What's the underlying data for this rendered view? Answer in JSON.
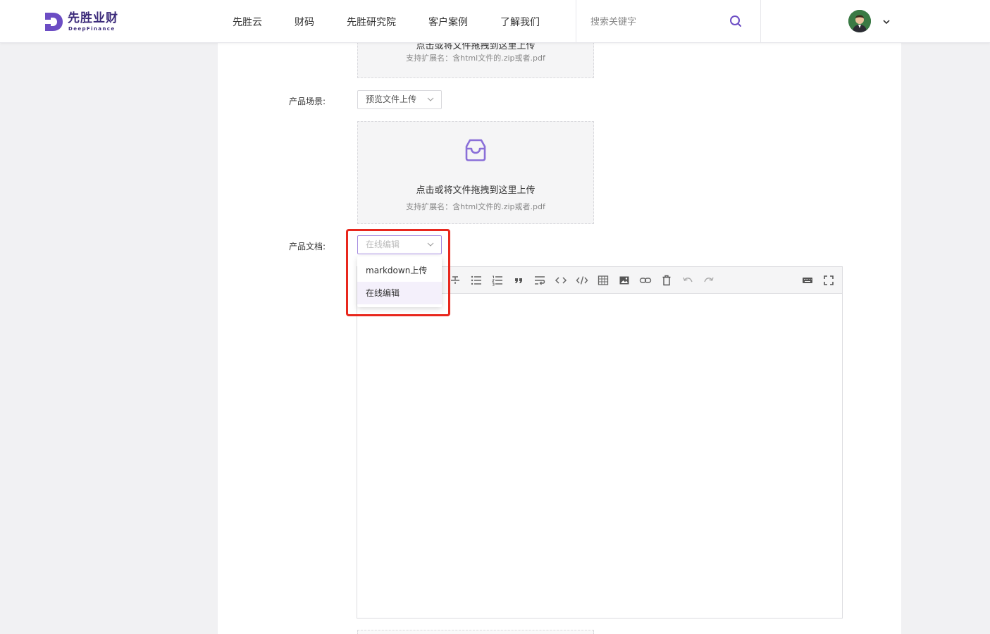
{
  "brand": {
    "name": "先胜业财",
    "sub": "DeepFinance",
    "color": "#6c4dc4"
  },
  "nav": [
    "先胜云",
    "财码",
    "先胜研究院",
    "客户案例",
    "了解我们"
  ],
  "search": {
    "placeholder": "搜索关键字"
  },
  "top_upload": {
    "title": "点击或将文件拖拽到这里上传",
    "hint": "支持扩展名：含html文件的.zip或者.pdf"
  },
  "scene": {
    "label": "产品场景:",
    "select_value": "预览文件上传"
  },
  "scene_upload": {
    "title": "点击或将文件拖拽到这里上传",
    "hint": "支持扩展名：含html文件的.zip或者.pdf"
  },
  "doc": {
    "label": "产品文档:",
    "select_placeholder": "在线编辑",
    "options": [
      "markdown上传",
      "在线编辑"
    ],
    "selected_option": "在线编辑"
  },
  "editor_toolbar": [
    "strikethrough-icon",
    "bullet-list-icon",
    "ordered-list-icon",
    "quote-icon",
    "wrap-icon",
    "code-inline-icon",
    "code-block-icon",
    "table-icon",
    "image-icon",
    "link-icon",
    "delete-icon",
    "undo-icon",
    "redo-icon",
    "keyboard-icon",
    "fullscreen-icon"
  ],
  "colors": {
    "accent": "#8a6fd8",
    "highlight": "#e8271d"
  }
}
